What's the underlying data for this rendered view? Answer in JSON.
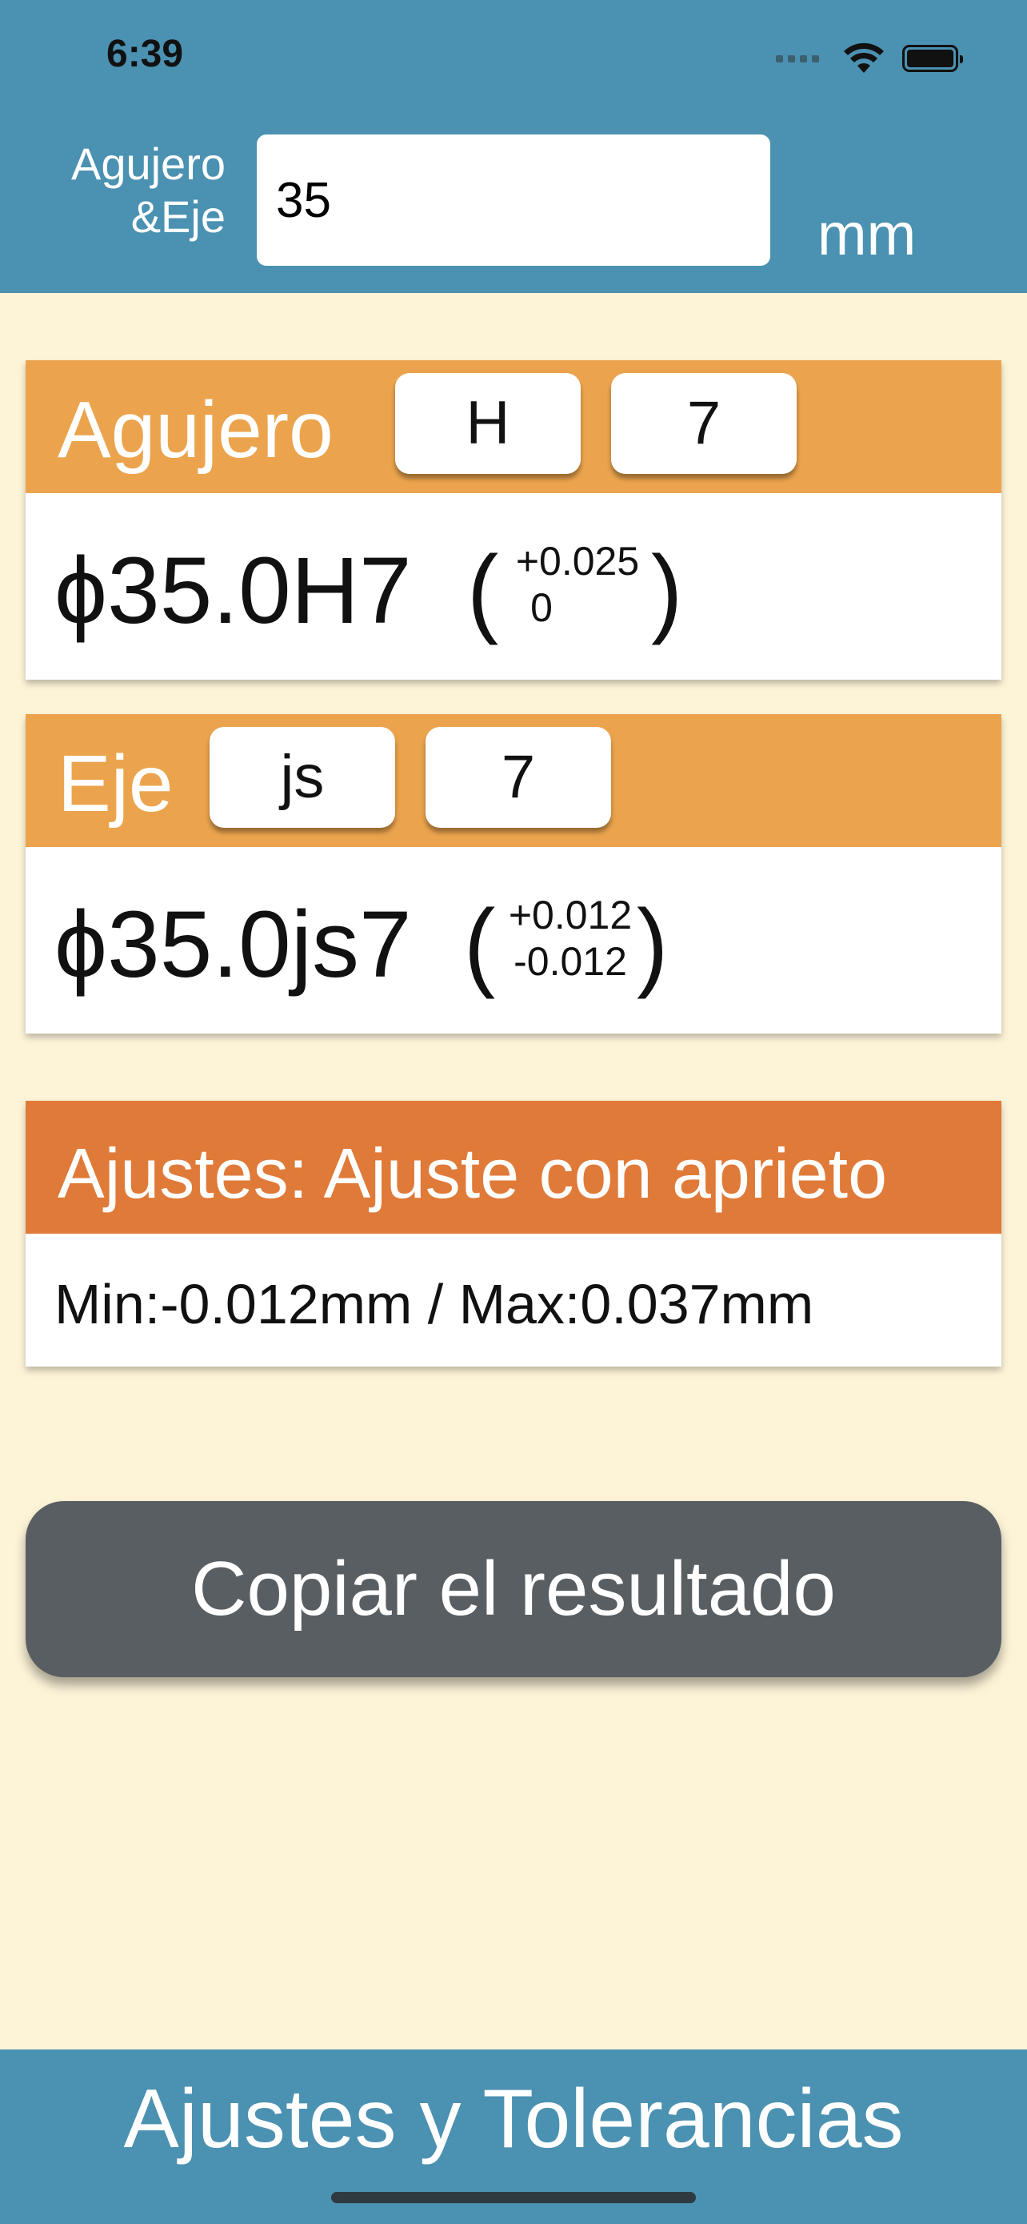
{
  "status_bar": {
    "time": "6:39"
  },
  "header": {
    "label_line1": "Agujero",
    "label_line2": "&Eje",
    "size_value": "35",
    "unit": "mm"
  },
  "hole": {
    "title": "Agujero",
    "letter": "H",
    "grade": "7",
    "designation": "ϕ35.0H7",
    "upper_deviation": "+0.025",
    "lower_deviation": "0"
  },
  "shaft": {
    "title": "Eje",
    "letter": "js",
    "grade": "7",
    "designation": "ϕ35.0js7",
    "upper_deviation": "+0.012",
    "lower_deviation": "-0.012"
  },
  "fit": {
    "title": "Ajustes: Ajuste con aprieto",
    "range": "Min:-0.012mm / Max:0.037mm"
  },
  "actions": {
    "copy_label": "Copiar el resultado"
  },
  "footer": {
    "title": "Ajustes y Tolerancias"
  },
  "colors": {
    "header_blue": "#4b91b1",
    "card_orange": "#eba44d",
    "fit_orange": "#e07a38",
    "background": "#fdf4d8",
    "button_gray": "#595e62"
  }
}
